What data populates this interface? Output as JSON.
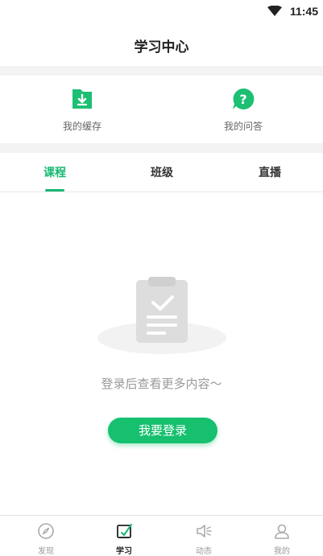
{
  "status": {
    "time": "11:45"
  },
  "header": {
    "title": "学习中心"
  },
  "quick": {
    "cache_label": "我的缓存",
    "qa_label": "我的问答"
  },
  "tabs": [
    {
      "label": "课程",
      "active": true
    },
    {
      "label": "班级",
      "active": false
    },
    {
      "label": "直播",
      "active": false
    }
  ],
  "empty": {
    "text": "登录后查看更多内容～",
    "login_label": "我要登录"
  },
  "nav": [
    {
      "label": "发现",
      "icon": "compass-icon"
    },
    {
      "label": "学习",
      "icon": "study-icon"
    },
    {
      "label": "动态",
      "icon": "speaker-icon"
    },
    {
      "label": "我的",
      "icon": "user-icon"
    }
  ],
  "colors": {
    "accent": "#16c06f",
    "tab_active": "#18b872"
  }
}
